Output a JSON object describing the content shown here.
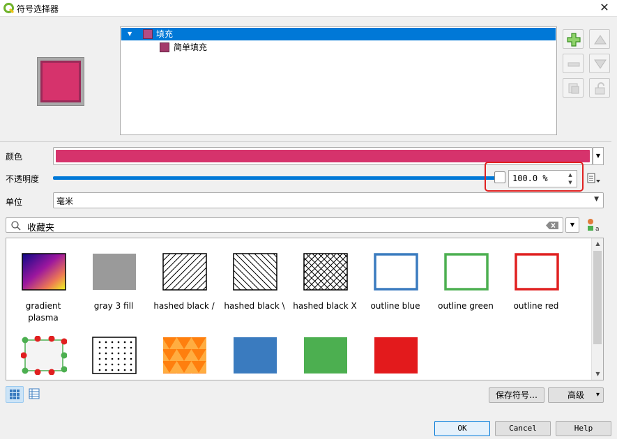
{
  "window": {
    "title": "符号选择器",
    "close_glyph": "✕"
  },
  "symbol_tree": {
    "root": {
      "label": "填充",
      "arrow": "▼",
      "selected": true
    },
    "child": {
      "label": "简单填充"
    }
  },
  "side_buttons": [
    {
      "name": "add-layer-icon",
      "enabled": true
    },
    {
      "name": "move-up-icon",
      "enabled": false
    },
    {
      "name": "remove-layer-icon",
      "enabled": false
    },
    {
      "name": "move-down-icon",
      "enabled": false
    },
    {
      "name": "duplicate-layer-icon",
      "enabled": false
    },
    {
      "name": "lock-icon",
      "enabled": false
    }
  ],
  "properties": {
    "color_label": "颜色",
    "color_value": "#d6336c",
    "opacity_label": "不透明度",
    "opacity_value": "100.0 %",
    "opacity_fraction": 1.0,
    "unit_label": "单位",
    "unit_value": "毫米"
  },
  "search": {
    "value": "收藏夹",
    "placeholder": ""
  },
  "gallery": {
    "items": [
      {
        "label": "gradient plasma",
        "kind": "gradient"
      },
      {
        "label": "gray 3 fill",
        "kind": "gray"
      },
      {
        "label": "hashed black /",
        "kind": "hatch-fwd"
      },
      {
        "label": "hashed black \\",
        "kind": "hatch-back"
      },
      {
        "label": "hashed black X",
        "kind": "hatch-x"
      },
      {
        "label": "outline blue",
        "kind": "outline",
        "color": "#3a7bbf"
      },
      {
        "label": "outline green",
        "kind": "outline",
        "color": "#4caf50"
      },
      {
        "label": "outline red",
        "kind": "outline",
        "color": "#e02020"
      },
      {
        "label": "",
        "kind": "vertex"
      },
      {
        "label": "",
        "kind": "dots"
      },
      {
        "label": "",
        "kind": "triangles"
      },
      {
        "label": "",
        "kind": "solid",
        "color": "#3a7bbf"
      },
      {
        "label": "",
        "kind": "solid",
        "color": "#4caf50"
      },
      {
        "label": "",
        "kind": "solid",
        "color": "#e31a1c"
      }
    ]
  },
  "buttons": {
    "save_symbol": "保存符号…",
    "advanced": "高级",
    "advanced_arrow": "▾",
    "ok": "OK",
    "cancel": "Cancel",
    "help": "Help"
  },
  "colors": {
    "accent": "#0078d7",
    "fill": "#d6336c",
    "highlight": "#e02020"
  }
}
